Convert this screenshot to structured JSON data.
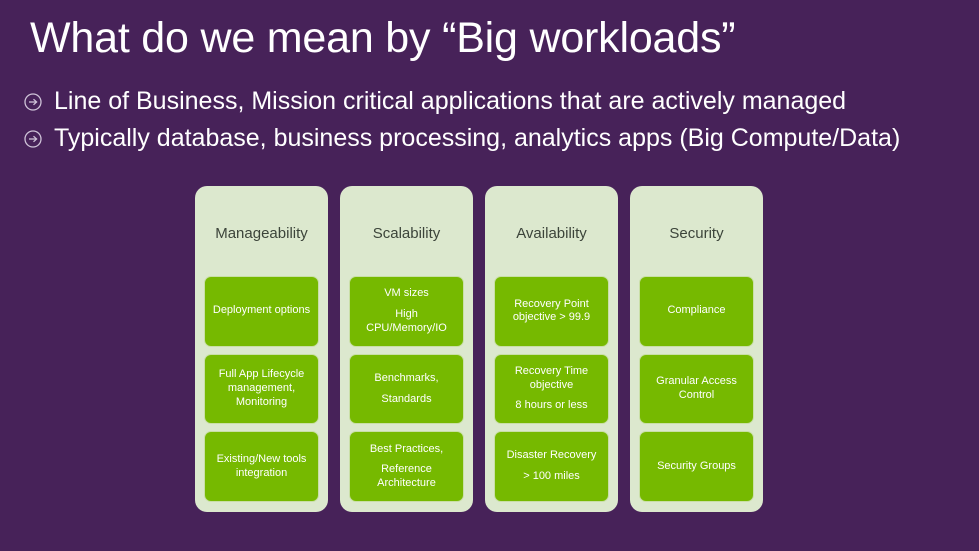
{
  "slide": {
    "title": "What do we mean by “Big workloads”",
    "background_color": "#472259",
    "accent_green": "#76b900",
    "panel_color": "#dce8ce",
    "bullets": [
      {
        "icon": "circled-arrow-right-icon",
        "text": "Line of Business, Mission critical applications that are actively managed"
      },
      {
        "icon": "circled-arrow-right-icon",
        "text": "Typically database, business processing, analytics apps (Big Compute/Data)"
      }
    ],
    "matrix": {
      "columns": [
        {
          "header": "Manageability",
          "cells": [
            {
              "lines": [
                "Deployment options"
              ]
            },
            {
              "lines": [
                "Full App Lifecycle management, Monitoring"
              ]
            },
            {
              "lines": [
                "Existing/New tools integration"
              ]
            }
          ]
        },
        {
          "header": "Scalability",
          "cells": [
            {
              "lines": [
                "VM sizes",
                "High CPU/Memory/IO"
              ]
            },
            {
              "lines": [
                "Benchmarks,",
                "Standards"
              ]
            },
            {
              "lines": [
                "Best Practices,",
                "Reference Architecture"
              ]
            }
          ]
        },
        {
          "header": "Availability",
          "cells": [
            {
              "lines": [
                "Recovery Point objective > 99.9"
              ]
            },
            {
              "lines": [
                "Recovery Time objective",
                "8 hours or less"
              ]
            },
            {
              "lines": [
                "Disaster Recovery",
                "> 100 miles"
              ]
            }
          ]
        },
        {
          "header": "Security",
          "cells": [
            {
              "lines": [
                "Compliance"
              ]
            },
            {
              "lines": [
                "Granular Access Control"
              ]
            },
            {
              "lines": [
                "Security Groups"
              ]
            }
          ]
        }
      ]
    }
  }
}
